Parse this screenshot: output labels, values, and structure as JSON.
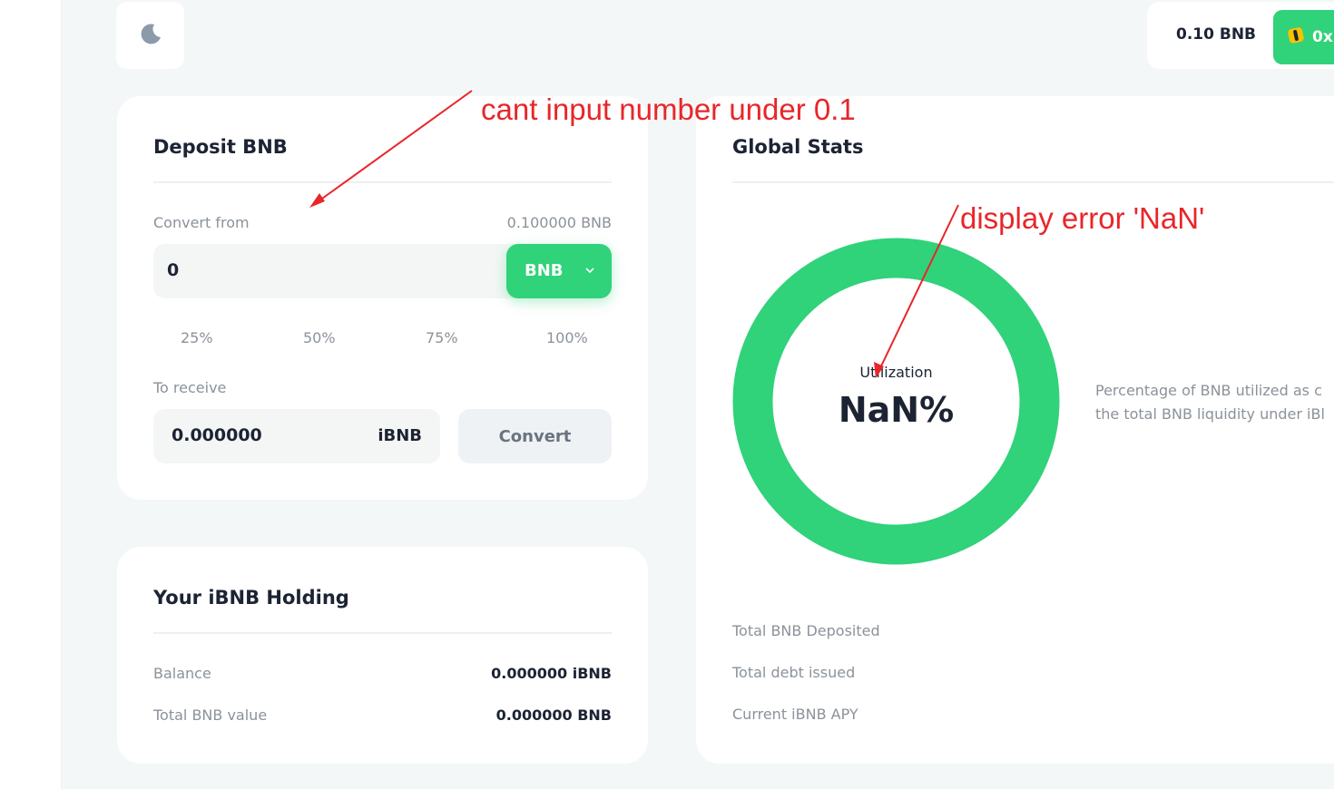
{
  "header": {
    "theme_icon": "moon-icon",
    "wallet_balance": "0.10 BNB",
    "wallet_address": "0x",
    "wallet_icon": "wallet-logo-icon"
  },
  "deposit": {
    "title": "Deposit BNB",
    "convert_from_label": "Convert from",
    "available_balance": "0.100000 BNB",
    "amount_value": "0",
    "token_label": "BNB",
    "percent_options": [
      "25%",
      "50%",
      "75%",
      "100%"
    ],
    "to_receive_label": "To receive",
    "receive_value": "0.000000",
    "receive_unit": "iBNB",
    "convert_button": "Convert"
  },
  "holding": {
    "title": "Your iBNB Holding",
    "rows": [
      {
        "label": "Balance",
        "value": "0.000000 iBNB"
      },
      {
        "label": "Total BNB value",
        "value": "0.000000 BNB"
      }
    ]
  },
  "stats": {
    "title": "Global Stats",
    "utilization_label": "Utilization",
    "utilization_value": "NaN%",
    "description_line1": "Percentage of BNB utilized as c",
    "description_line2": "the total BNB liquidity under iBl",
    "rows": [
      "Total BNB Deposited",
      "Total debt issued",
      "Current iBNB APY"
    ]
  },
  "annotations": {
    "note1": "cant input number under 0.1",
    "note2": "display error 'NaN'"
  },
  "colors": {
    "accent": "#30d27a",
    "annotation": "#e8262a",
    "background": "#f4f7f7"
  }
}
